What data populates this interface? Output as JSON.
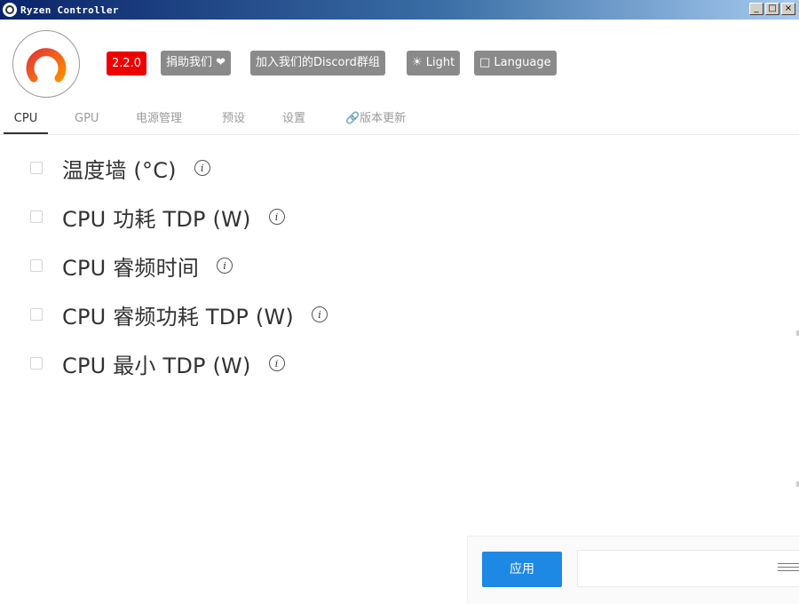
{
  "window": {
    "title": "Ryzen Controller",
    "controls": [
      "_",
      "□",
      "×"
    ]
  },
  "header": {
    "version": "2.2.0",
    "donate_label": "捐助我们 ❤",
    "discord_label": "加入我们的Discord群组",
    "theme_label": "☀ Light",
    "language_label": "□ Language",
    "colors": {
      "version_badge": "#ee0000",
      "header_button": "#8a8a8a",
      "logo_ring_start": "#e53935",
      "logo_ring_end": "#fb8c00"
    }
  },
  "tabs": [
    {
      "label": "CPU",
      "active": true
    },
    {
      "label": "GPU",
      "active": false
    },
    {
      "label": "电源管理",
      "active": false
    },
    {
      "label": "预设",
      "active": false
    },
    {
      "label": "设置",
      "active": false
    },
    {
      "label": "🔗版本更新",
      "active": false
    }
  ],
  "settings": [
    {
      "label": "温度墙 (°C)",
      "checked": false
    },
    {
      "label": "CPU 功耗 TDP (W)",
      "checked": false
    },
    {
      "label": "CPU 睿频时间",
      "checked": false
    },
    {
      "label": "CPU 睿频功耗 TDP (W)",
      "checked": false
    },
    {
      "label": "CPU 最小 TDP (W)",
      "checked": false
    }
  ],
  "footer": {
    "apply_label": "应用",
    "output_value": "",
    "apply_color": "#1e88e5"
  }
}
